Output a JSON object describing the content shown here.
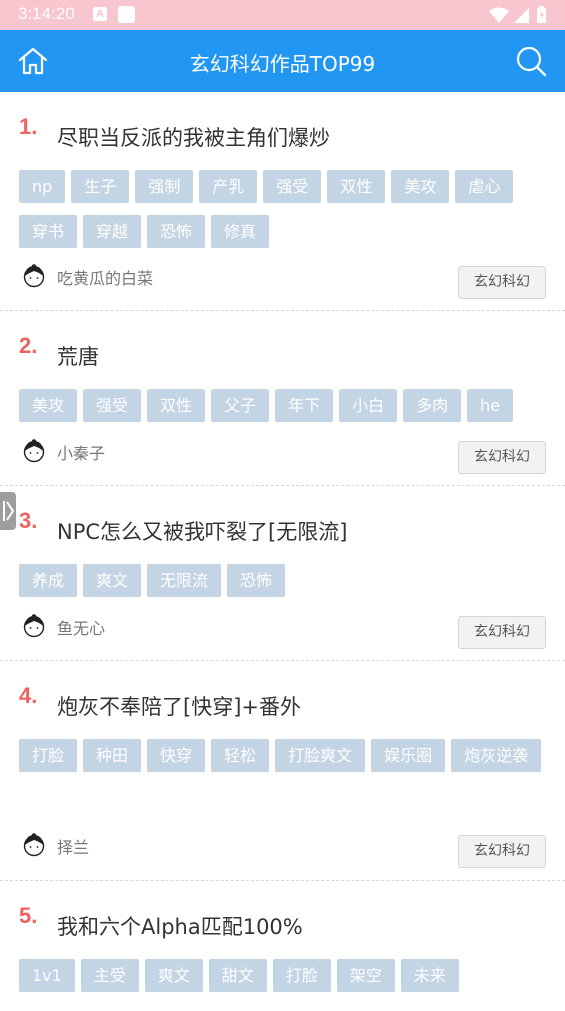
{
  "status_bar": {
    "time": "3:14:20",
    "notification_badge": "A",
    "icons": [
      "wifi-icon",
      "signal-icon",
      "battery-icon"
    ]
  },
  "header": {
    "title": "玄幻科幻作品TOP99",
    "left_icon": "home-icon",
    "right_icon": "search-icon",
    "color": "#2196f3"
  },
  "items": [
    {
      "rank": "1.",
      "title": "尽职当反派的我被主角们爆炒",
      "tags": [
        "np",
        "生子",
        "强制",
        "产乳",
        "强受",
        "双性",
        "美攻",
        "虐心",
        "穿书",
        "穿越",
        "恐怖",
        "修真"
      ],
      "author": "吃黄瓜的白菜",
      "category": "玄幻科幻"
    },
    {
      "rank": "2.",
      "title": "荒唐",
      "tags": [
        "美攻",
        "强受",
        "双性",
        "父子",
        "年下",
        "小白",
        "多肉",
        "he"
      ],
      "author": "小秦子",
      "category": "玄幻科幻"
    },
    {
      "rank": "3.",
      "title": "NPC怎么又被我吓裂了[无限流]",
      "tags": [
        "养成",
        "爽文",
        "无限流",
        "恐怖"
      ],
      "author": "鱼无心",
      "category": "玄幻科幻"
    },
    {
      "rank": "4.",
      "title": "炮灰不奉陪了[快穿]+番外",
      "tags": [
        "打脸",
        "种田",
        "快穿",
        "轻松",
        "打脸爽文",
        "娱乐圈",
        "炮灰逆袭"
      ],
      "author": "择兰",
      "category": "玄幻科幻"
    },
    {
      "rank": "5.",
      "title": "我和六个Alpha匹配100%",
      "tags": [
        "1v1",
        "主受",
        "爽文",
        "甜文",
        "打脸",
        "架空",
        "未来"
      ],
      "author": "",
      "category": ""
    }
  ],
  "colors": {
    "rank": "#f06161",
    "tag_bg": "#c3d4e5",
    "status_bar": "#f7c6cf"
  }
}
